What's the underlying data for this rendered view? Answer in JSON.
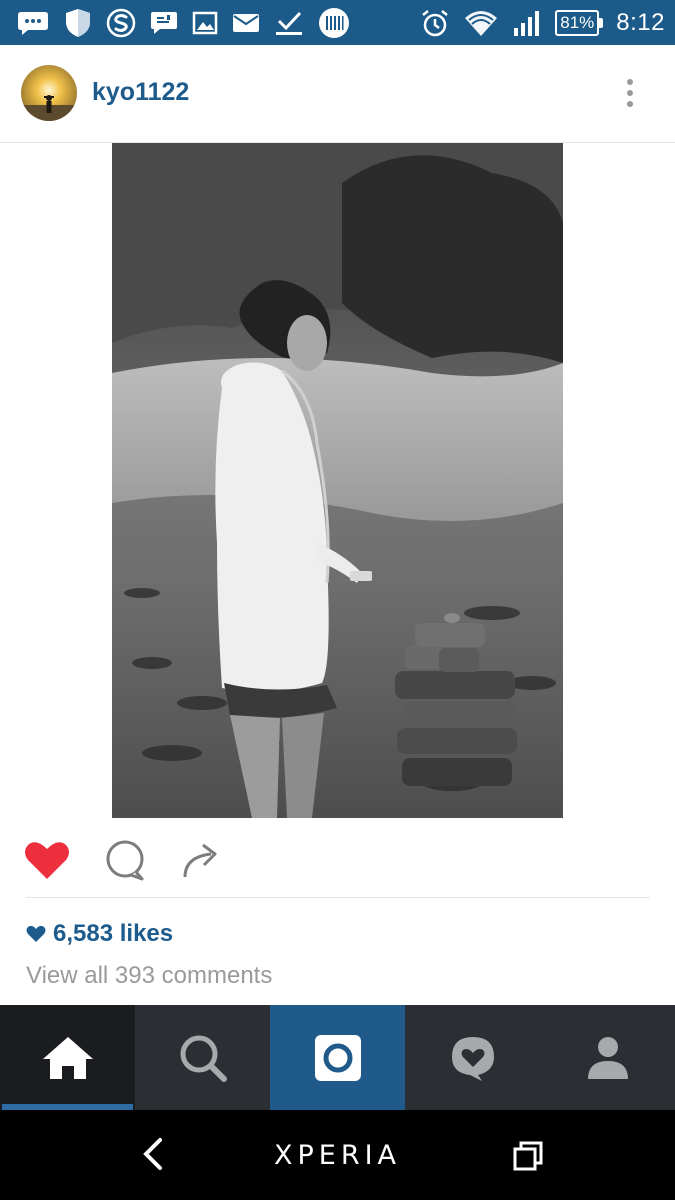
{
  "status_bar": {
    "icons": [
      "chat-bubble-icon",
      "shield-icon",
      "skype-icon",
      "message-icon",
      "image-icon",
      "mail-icon",
      "check-download-icon",
      "barcode-icon",
      "alarm-icon",
      "wifi-icon",
      "signal-icon"
    ],
    "battery": "81%",
    "time": "8:12"
  },
  "post": {
    "username": "kyo1122",
    "avatar_icon": "user-avatar",
    "photo_description_icon": "post-photo",
    "likes": "6,583 likes",
    "comments_link": "View all 393 comments"
  },
  "actions": {
    "like_icon": "heart-filled-icon",
    "comment_icon": "comment-icon",
    "share_icon": "share-arrow-icon",
    "liked": true
  },
  "tabs": [
    {
      "name": "home",
      "icon": "home-icon",
      "active": true
    },
    {
      "name": "search",
      "icon": "search-icon",
      "active": false
    },
    {
      "name": "camera",
      "icon": "camera-icon",
      "active": false
    },
    {
      "name": "activity",
      "icon": "activity-heart-icon",
      "active": false
    },
    {
      "name": "profile",
      "icon": "profile-icon",
      "active": false
    }
  ],
  "system_nav": {
    "brand": "XPERIA"
  },
  "colors": {
    "status_bar": "#1b5a89",
    "accent": "#1c5b8c",
    "like_red": "#ed2f3d",
    "tabbar": "#2b2e33",
    "tab_camera": "#1f5a8b"
  }
}
